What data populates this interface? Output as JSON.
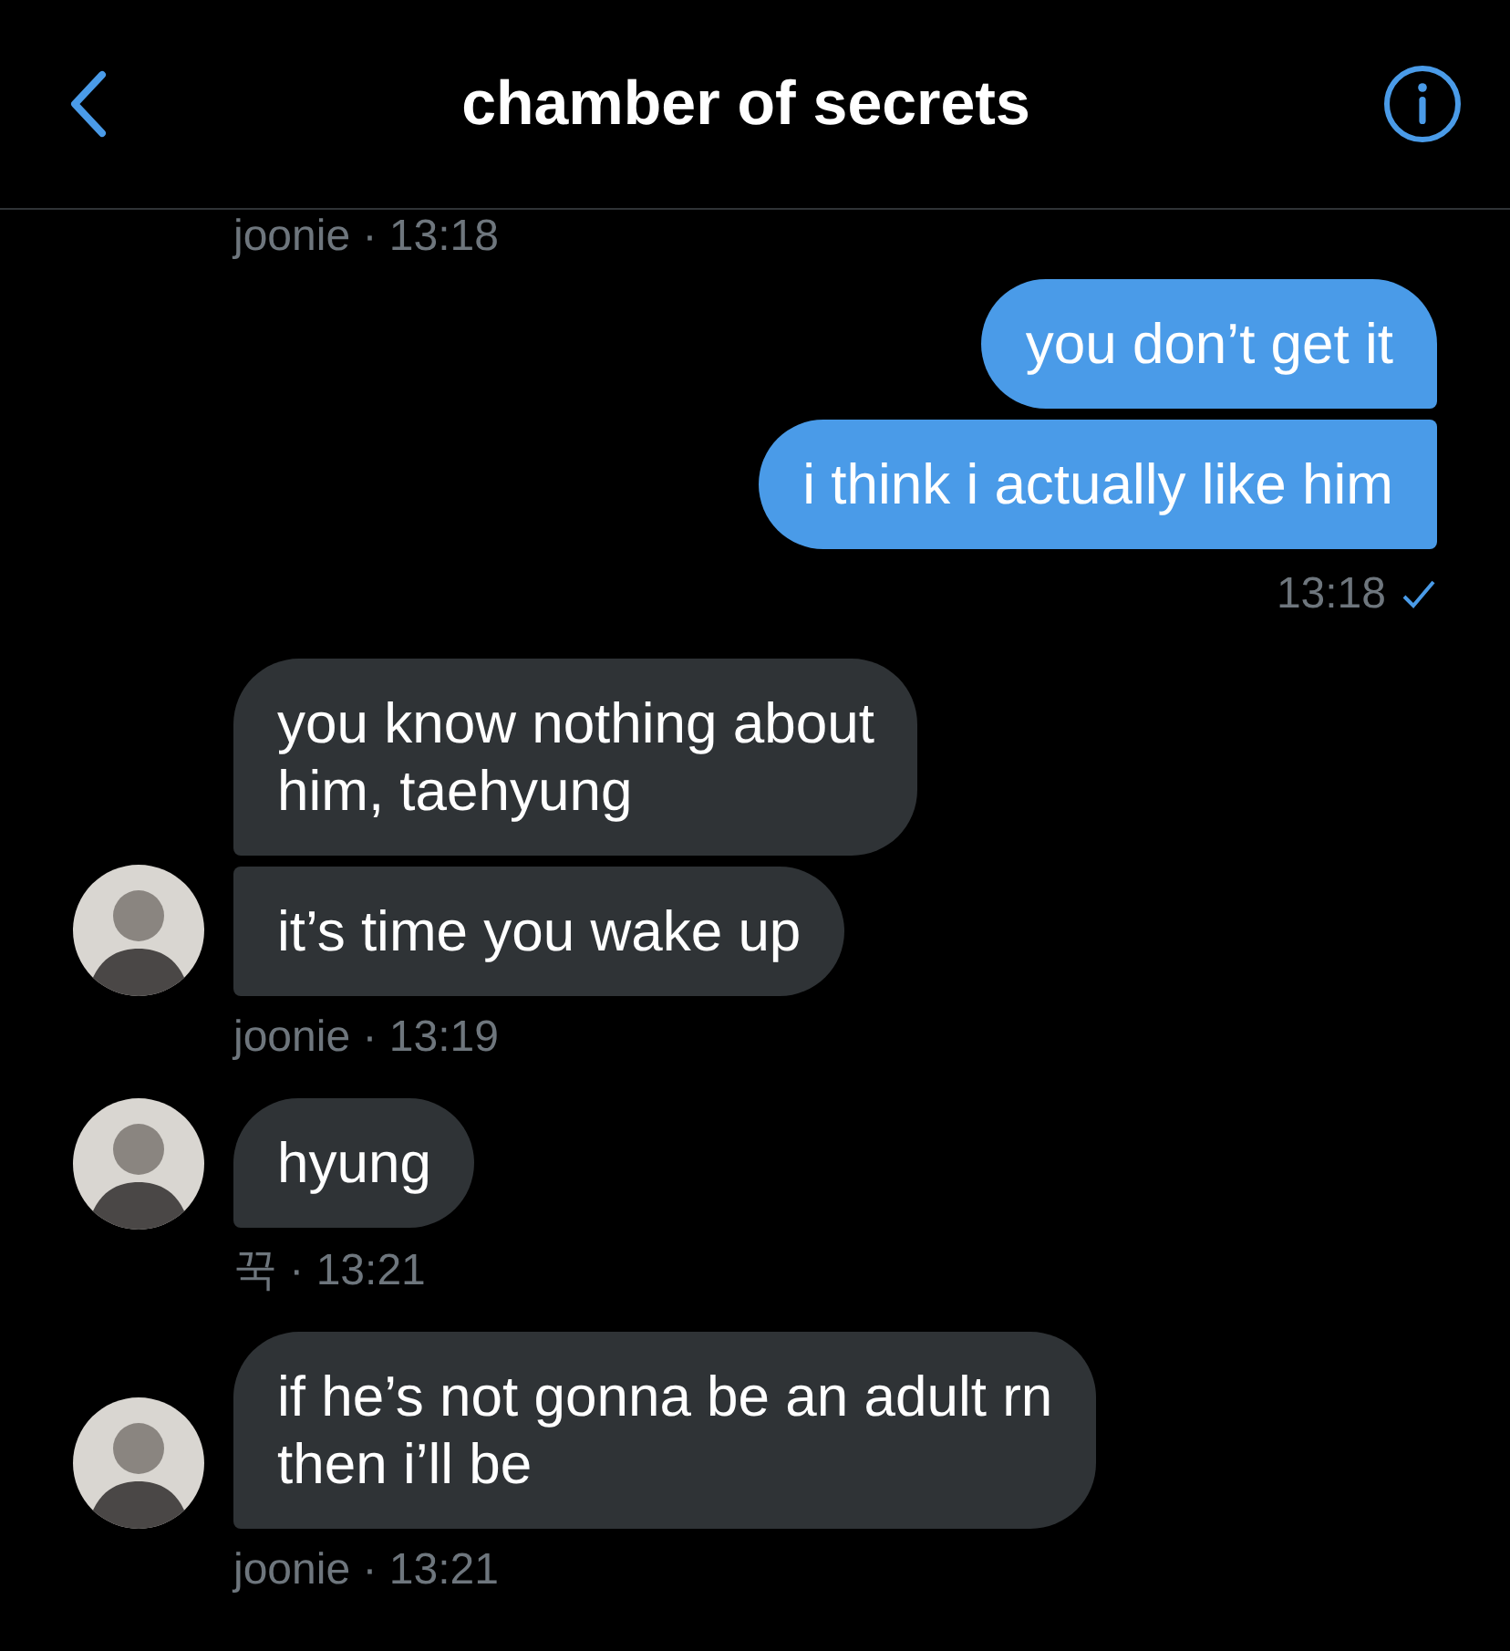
{
  "header": {
    "title": "chamber of secrets"
  },
  "thread": [
    {
      "kind": "meta",
      "meta": "joonie · 13:18"
    },
    {
      "kind": "sent",
      "bubbles": [
        "you don’t get it",
        "i think i actually like him"
      ],
      "meta": "13:18",
      "seen": true
    },
    {
      "kind": "received",
      "bubbles": [
        "you know nothing about\nhim, taehyung",
        "it’s time you wake up"
      ],
      "meta": "joonie · 13:19"
    },
    {
      "kind": "received",
      "bubbles": [
        "hyung"
      ],
      "meta": "꾹 · 13:21"
    },
    {
      "kind": "received",
      "bubbles": [
        "if he’s not gonna be an adult rn\nthen i’ll be"
      ],
      "meta": "joonie · 13:21"
    }
  ]
}
